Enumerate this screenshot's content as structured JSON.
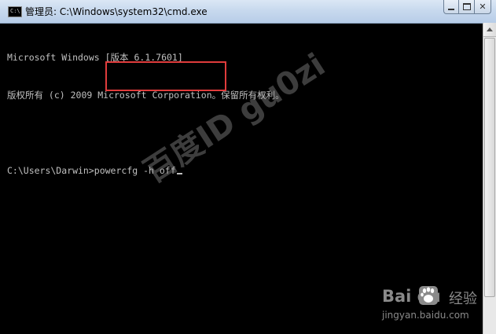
{
  "window": {
    "title": "管理员: C:\\Windows\\system32\\cmd.exe",
    "icon_label": "C:\\",
    "controls": {
      "minimize": "minimize",
      "maximize": "maximize",
      "close": "✕"
    }
  },
  "console": {
    "lines": [
      "Microsoft Windows [版本 6.1.7601]",
      "版权所有 (c) 2009 Microsoft Corporation。保留所有权利。",
      "",
      "C:\\Users\\Darwin>powercfg -h off"
    ]
  },
  "colors": {
    "console_bg": "#000000",
    "console_text": "#c0c0c0",
    "highlight_box": "#e03c3c"
  },
  "watermark": {
    "text": "百度ID gu0zi"
  },
  "baidu": {
    "brand": "Bai  du",
    "product": "经验",
    "url": "jingyan.baidu.com"
  }
}
